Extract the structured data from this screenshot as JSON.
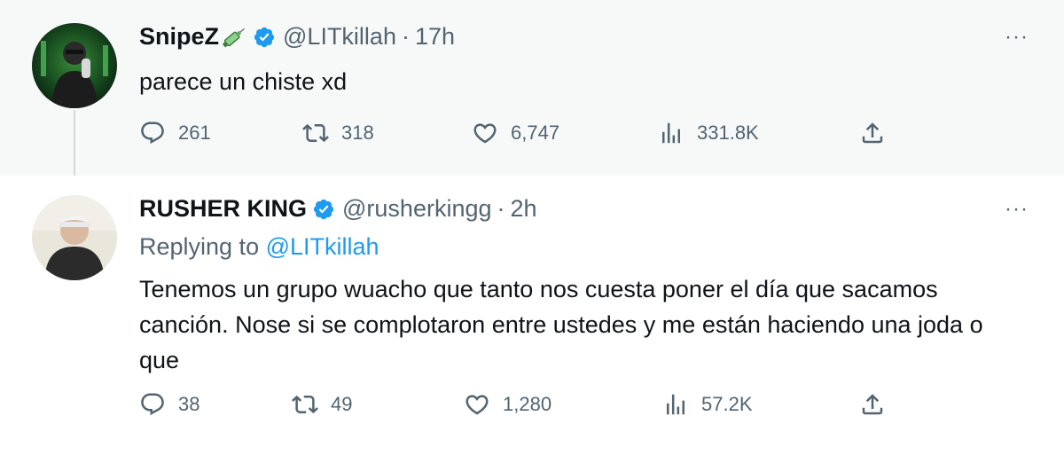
{
  "tweets": [
    {
      "name": "SnipeZ",
      "name_emoji": "syringe-icon",
      "verified": true,
      "handle": "@LITkillah",
      "dot": "·",
      "time": "17h",
      "more": "···",
      "text": "parece un chiste xd",
      "replies": "261",
      "retweets": "318",
      "likes": "6,747",
      "views": "331.8K"
    },
    {
      "name": "RUSHER KING",
      "verified": true,
      "handle": "@rusherkingg",
      "dot": "·",
      "time": "2h",
      "more": "···",
      "replying_prefix": "Replying to",
      "replying_handle": "@LITkillah",
      "text": "Tenemos un grupo wuacho que tanto nos cuesta poner el día que sacamos canción. Nose si se complotaron entre ustedes y me están haciendo una joda o que",
      "replies": "38",
      "retweets": "49",
      "likes": "1,280",
      "views": "57.2K"
    }
  ],
  "colors": {
    "verified": "#1d9bf0",
    "link": "#1d9bf0",
    "secondary": "#536471",
    "primary_text": "#0f1419",
    "first_tweet_bg": "#f7f9f9",
    "thread_line": "#cfd9de"
  }
}
